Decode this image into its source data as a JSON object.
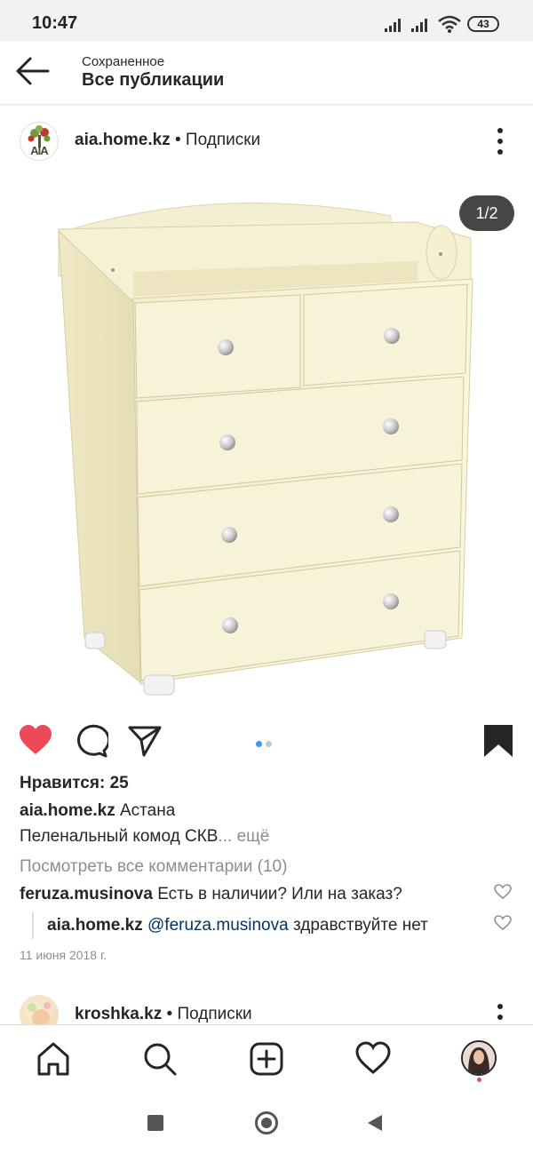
{
  "status_bar": {
    "time": "10:47",
    "battery": "43"
  },
  "header": {
    "subtitle": "Сохраненное",
    "title": "Все публикации"
  },
  "post": {
    "username": "aia.home.kz",
    "follow_label": "• Подписки",
    "avatar_text": "AIA",
    "image_counter": "1/2",
    "likes": "Нравится: 25",
    "caption_user": "aia.home.kz",
    "location": "Астана",
    "caption_text": "Пеленальный комод СКВ",
    "caption_more": "... ещё",
    "view_comments": "Посмотреть все комментарии (10)",
    "comments": [
      {
        "user": "feruza.musinova",
        "text": "Есть в наличии? Или на заказ?"
      }
    ],
    "reply": {
      "user": "aia.home.kz",
      "mention": "@feruza.musinova",
      "text": "здравствуйте нет"
    },
    "date": "11 июня 2018 г.",
    "carousel": {
      "count": 2,
      "active": 1
    },
    "liked": true,
    "saved": true
  },
  "next_post": {
    "username": "kroshka.kz",
    "follow_label": "• Подписки"
  },
  "bottom_nav": {
    "items": [
      "home-icon",
      "search-icon",
      "add-post-icon",
      "activity-heart-icon",
      "profile-avatar"
    ]
  },
  "colors": {
    "like_red": "#ed4956",
    "carousel_blue": "#3897f0",
    "mention_blue": "#003569",
    "dresser_cream": "#f6f1cf"
  }
}
